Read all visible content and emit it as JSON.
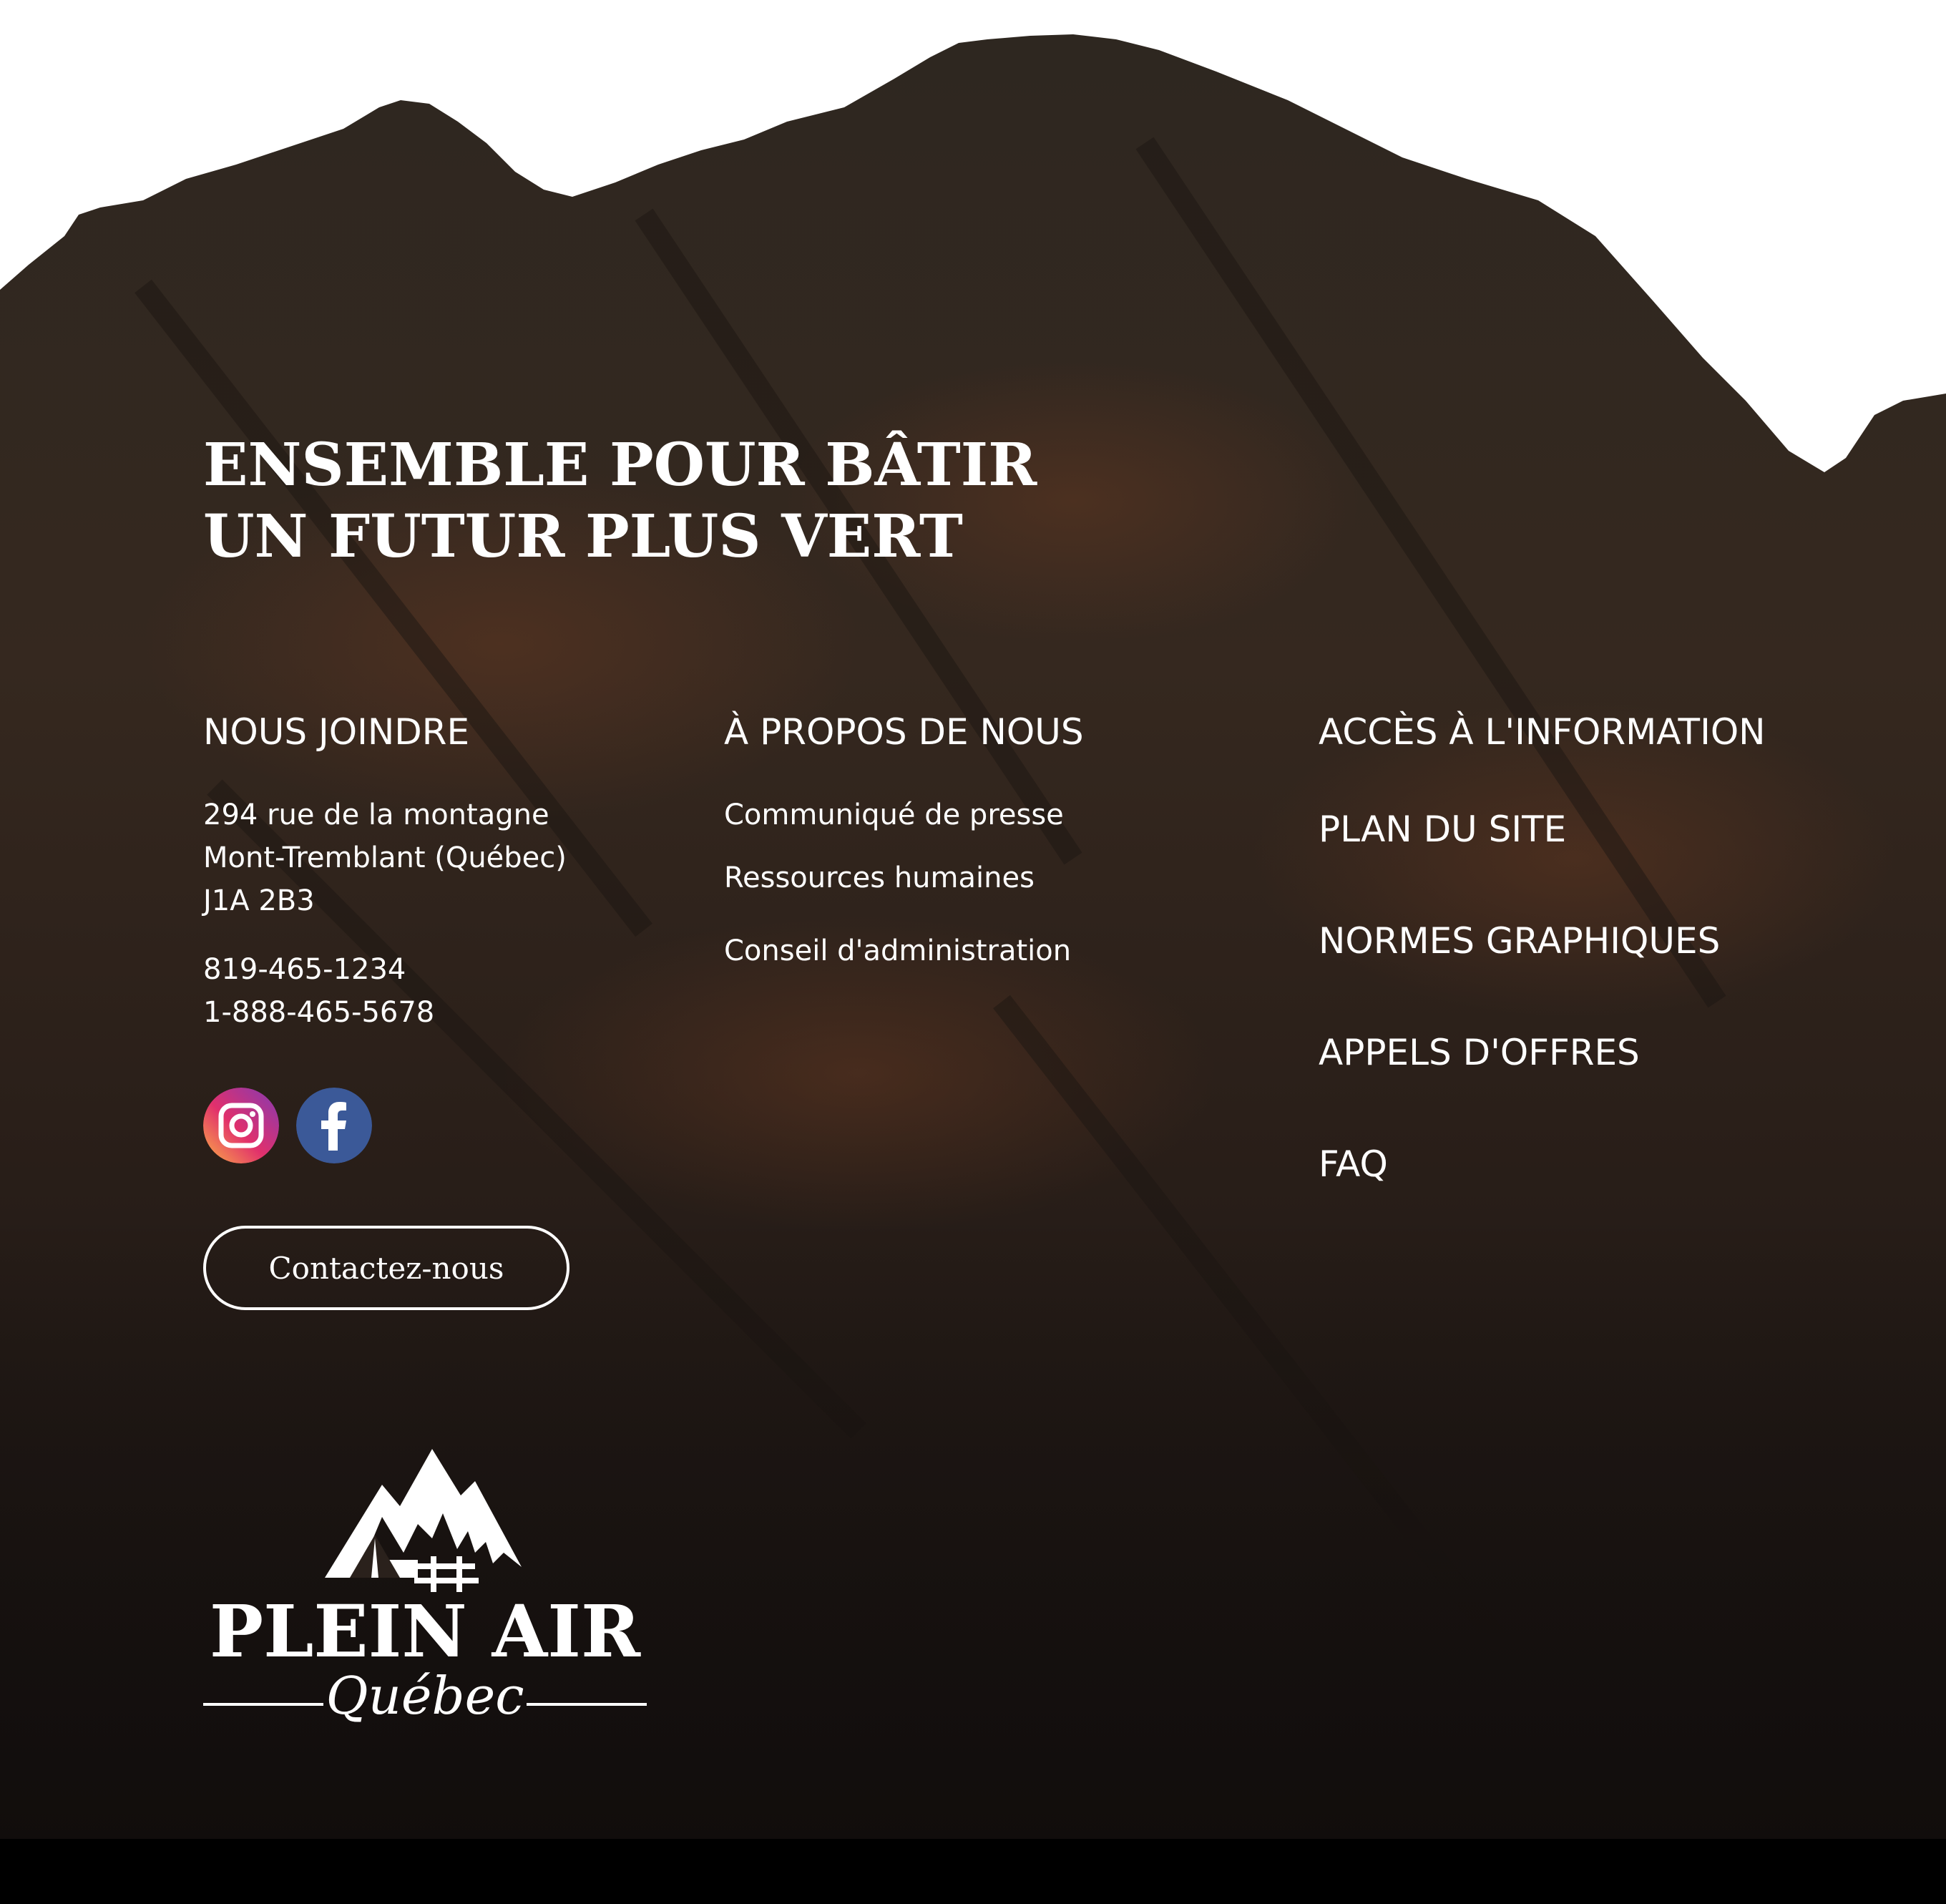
{
  "hero": {
    "title_line1": "ENSEMBLE POUR BÂTIR",
    "title_line2": "UN FUTUR PLUS VERT"
  },
  "contact": {
    "title": "NOUS JOINDRE",
    "address_line1": "294 rue de la montagne",
    "address_line2": "Mont-Tremblant (Québec)",
    "address_line3": "J1A 2B3",
    "phone1": "819-465-1234",
    "phone2": "1-888-465-5678",
    "button_label": "Contactez-nous",
    "social": [
      {
        "name": "instagram",
        "icon": "instagram-icon"
      },
      {
        "name": "facebook",
        "icon": "facebook-icon"
      }
    ]
  },
  "about": {
    "title": "À PROPOS DE NOUS",
    "links": [
      "Communiqué de presse",
      "Ressources humaines",
      "Conseil d'administration"
    ]
  },
  "info": {
    "title": "ACCÈS À L'INFORMATION",
    "links": [
      "PLAN DU SITE",
      "NORMES GRAPHIQUES",
      "APPELS D'OFFRES",
      "FAQ"
    ]
  },
  "logo": {
    "main": "PLEIN AIR",
    "sub": "Québec"
  },
  "colors": {
    "background_dark": "#2a211c",
    "bottom_bar": "#000000",
    "text": "#ffffff",
    "facebook": "#3b5998"
  }
}
